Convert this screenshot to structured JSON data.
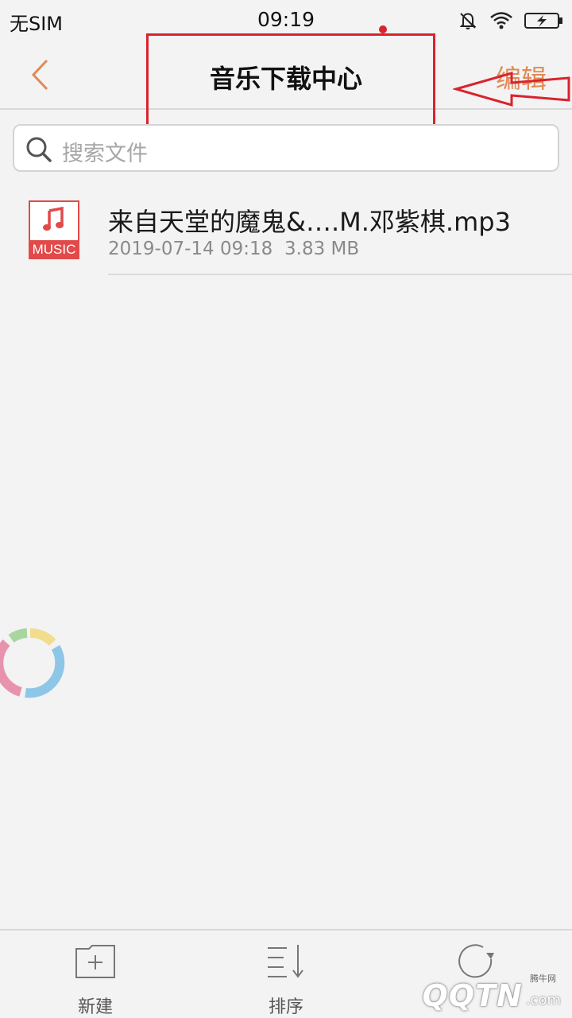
{
  "status_bar": {
    "carrier": "无SIM",
    "time": "09:19",
    "icons": [
      "mute-bell-icon",
      "wifi-icon",
      "battery-charging-icon"
    ]
  },
  "header": {
    "back_icon": "chevron-left-icon",
    "title": "音乐下载中心",
    "edit_label": "编辑"
  },
  "search": {
    "icon": "search-icon",
    "placeholder": "搜索文件"
  },
  "files": [
    {
      "thumb_label": "MUSIC",
      "name": "来自天堂的魔鬼&….M.邓紫棋.mp3",
      "date": "2019-07-14 09:18",
      "size": "3.83 MB"
    }
  ],
  "toolbar": {
    "new_label": "新建",
    "sort_label": "排序",
    "refresh_label": ""
  },
  "watermark": {
    "logo": "QQTN",
    "tld": ".com",
    "sub": "腾牛网"
  },
  "colors": {
    "accent": "#e08a55",
    "annotation": "#d9232d",
    "music_red": "#e24a4a",
    "background": "#f3f3f3"
  }
}
